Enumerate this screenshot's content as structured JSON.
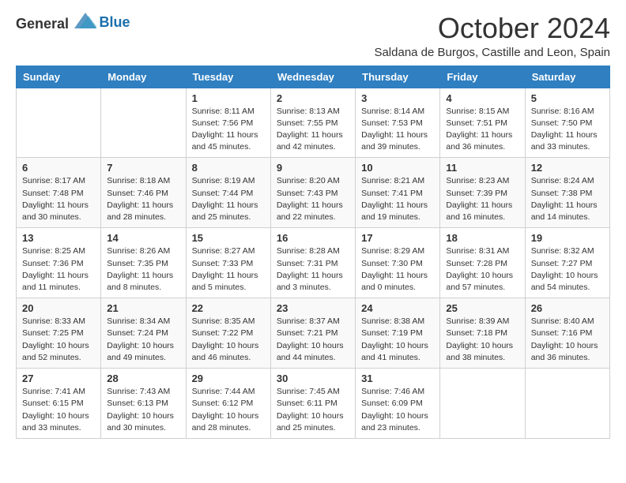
{
  "logo": {
    "general": "General",
    "blue": "Blue"
  },
  "title": {
    "month_year": "October 2024",
    "location": "Saldana de Burgos, Castille and Leon, Spain"
  },
  "weekdays": [
    "Sunday",
    "Monday",
    "Tuesday",
    "Wednesday",
    "Thursday",
    "Friday",
    "Saturday"
  ],
  "weeks": [
    [
      {
        "day": "",
        "info": ""
      },
      {
        "day": "",
        "info": ""
      },
      {
        "day": "1",
        "info": "Sunrise: 8:11 AM\nSunset: 7:56 PM\nDaylight: 11 hours and 45 minutes."
      },
      {
        "day": "2",
        "info": "Sunrise: 8:13 AM\nSunset: 7:55 PM\nDaylight: 11 hours and 42 minutes."
      },
      {
        "day": "3",
        "info": "Sunrise: 8:14 AM\nSunset: 7:53 PM\nDaylight: 11 hours and 39 minutes."
      },
      {
        "day": "4",
        "info": "Sunrise: 8:15 AM\nSunset: 7:51 PM\nDaylight: 11 hours and 36 minutes."
      },
      {
        "day": "5",
        "info": "Sunrise: 8:16 AM\nSunset: 7:50 PM\nDaylight: 11 hours and 33 minutes."
      }
    ],
    [
      {
        "day": "6",
        "info": "Sunrise: 8:17 AM\nSunset: 7:48 PM\nDaylight: 11 hours and 30 minutes."
      },
      {
        "day": "7",
        "info": "Sunrise: 8:18 AM\nSunset: 7:46 PM\nDaylight: 11 hours and 28 minutes."
      },
      {
        "day": "8",
        "info": "Sunrise: 8:19 AM\nSunset: 7:44 PM\nDaylight: 11 hours and 25 minutes."
      },
      {
        "day": "9",
        "info": "Sunrise: 8:20 AM\nSunset: 7:43 PM\nDaylight: 11 hours and 22 minutes."
      },
      {
        "day": "10",
        "info": "Sunrise: 8:21 AM\nSunset: 7:41 PM\nDaylight: 11 hours and 19 minutes."
      },
      {
        "day": "11",
        "info": "Sunrise: 8:23 AM\nSunset: 7:39 PM\nDaylight: 11 hours and 16 minutes."
      },
      {
        "day": "12",
        "info": "Sunrise: 8:24 AM\nSunset: 7:38 PM\nDaylight: 11 hours and 14 minutes."
      }
    ],
    [
      {
        "day": "13",
        "info": "Sunrise: 8:25 AM\nSunset: 7:36 PM\nDaylight: 11 hours and 11 minutes."
      },
      {
        "day": "14",
        "info": "Sunrise: 8:26 AM\nSunset: 7:35 PM\nDaylight: 11 hours and 8 minutes."
      },
      {
        "day": "15",
        "info": "Sunrise: 8:27 AM\nSunset: 7:33 PM\nDaylight: 11 hours and 5 minutes."
      },
      {
        "day": "16",
        "info": "Sunrise: 8:28 AM\nSunset: 7:31 PM\nDaylight: 11 hours and 3 minutes."
      },
      {
        "day": "17",
        "info": "Sunrise: 8:29 AM\nSunset: 7:30 PM\nDaylight: 11 hours and 0 minutes."
      },
      {
        "day": "18",
        "info": "Sunrise: 8:31 AM\nSunset: 7:28 PM\nDaylight: 10 hours and 57 minutes."
      },
      {
        "day": "19",
        "info": "Sunrise: 8:32 AM\nSunset: 7:27 PM\nDaylight: 10 hours and 54 minutes."
      }
    ],
    [
      {
        "day": "20",
        "info": "Sunrise: 8:33 AM\nSunset: 7:25 PM\nDaylight: 10 hours and 52 minutes."
      },
      {
        "day": "21",
        "info": "Sunrise: 8:34 AM\nSunset: 7:24 PM\nDaylight: 10 hours and 49 minutes."
      },
      {
        "day": "22",
        "info": "Sunrise: 8:35 AM\nSunset: 7:22 PM\nDaylight: 10 hours and 46 minutes."
      },
      {
        "day": "23",
        "info": "Sunrise: 8:37 AM\nSunset: 7:21 PM\nDaylight: 10 hours and 44 minutes."
      },
      {
        "day": "24",
        "info": "Sunrise: 8:38 AM\nSunset: 7:19 PM\nDaylight: 10 hours and 41 minutes."
      },
      {
        "day": "25",
        "info": "Sunrise: 8:39 AM\nSunset: 7:18 PM\nDaylight: 10 hours and 38 minutes."
      },
      {
        "day": "26",
        "info": "Sunrise: 8:40 AM\nSunset: 7:16 PM\nDaylight: 10 hours and 36 minutes."
      }
    ],
    [
      {
        "day": "27",
        "info": "Sunrise: 7:41 AM\nSunset: 6:15 PM\nDaylight: 10 hours and 33 minutes."
      },
      {
        "day": "28",
        "info": "Sunrise: 7:43 AM\nSunset: 6:13 PM\nDaylight: 10 hours and 30 minutes."
      },
      {
        "day": "29",
        "info": "Sunrise: 7:44 AM\nSunset: 6:12 PM\nDaylight: 10 hours and 28 minutes."
      },
      {
        "day": "30",
        "info": "Sunrise: 7:45 AM\nSunset: 6:11 PM\nDaylight: 10 hours and 25 minutes."
      },
      {
        "day": "31",
        "info": "Sunrise: 7:46 AM\nSunset: 6:09 PM\nDaylight: 10 hours and 23 minutes."
      },
      {
        "day": "",
        "info": ""
      },
      {
        "day": "",
        "info": ""
      }
    ]
  ]
}
